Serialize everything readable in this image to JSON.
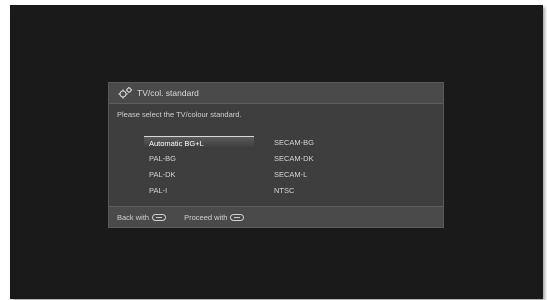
{
  "dialog": {
    "title": "TV/col. standard",
    "prompt": "Please select the TV/colour standard.",
    "options": [
      {
        "label": "Automatic BG+L",
        "selected": true
      },
      {
        "label": "PAL-BG"
      },
      {
        "label": "PAL-DK"
      },
      {
        "label": "PAL-I"
      },
      {
        "label": "SECAM-BG"
      },
      {
        "label": "SECAM-DK"
      },
      {
        "label": "SECAM-L"
      },
      {
        "label": "NTSC"
      }
    ],
    "footer": {
      "back_label": "Back with",
      "proceed_label": "Proceed with"
    }
  },
  "icons": {
    "title_icon": "gear-icon",
    "back_key": "remote-button-icon",
    "proceed_key": "remote-button-icon"
  }
}
